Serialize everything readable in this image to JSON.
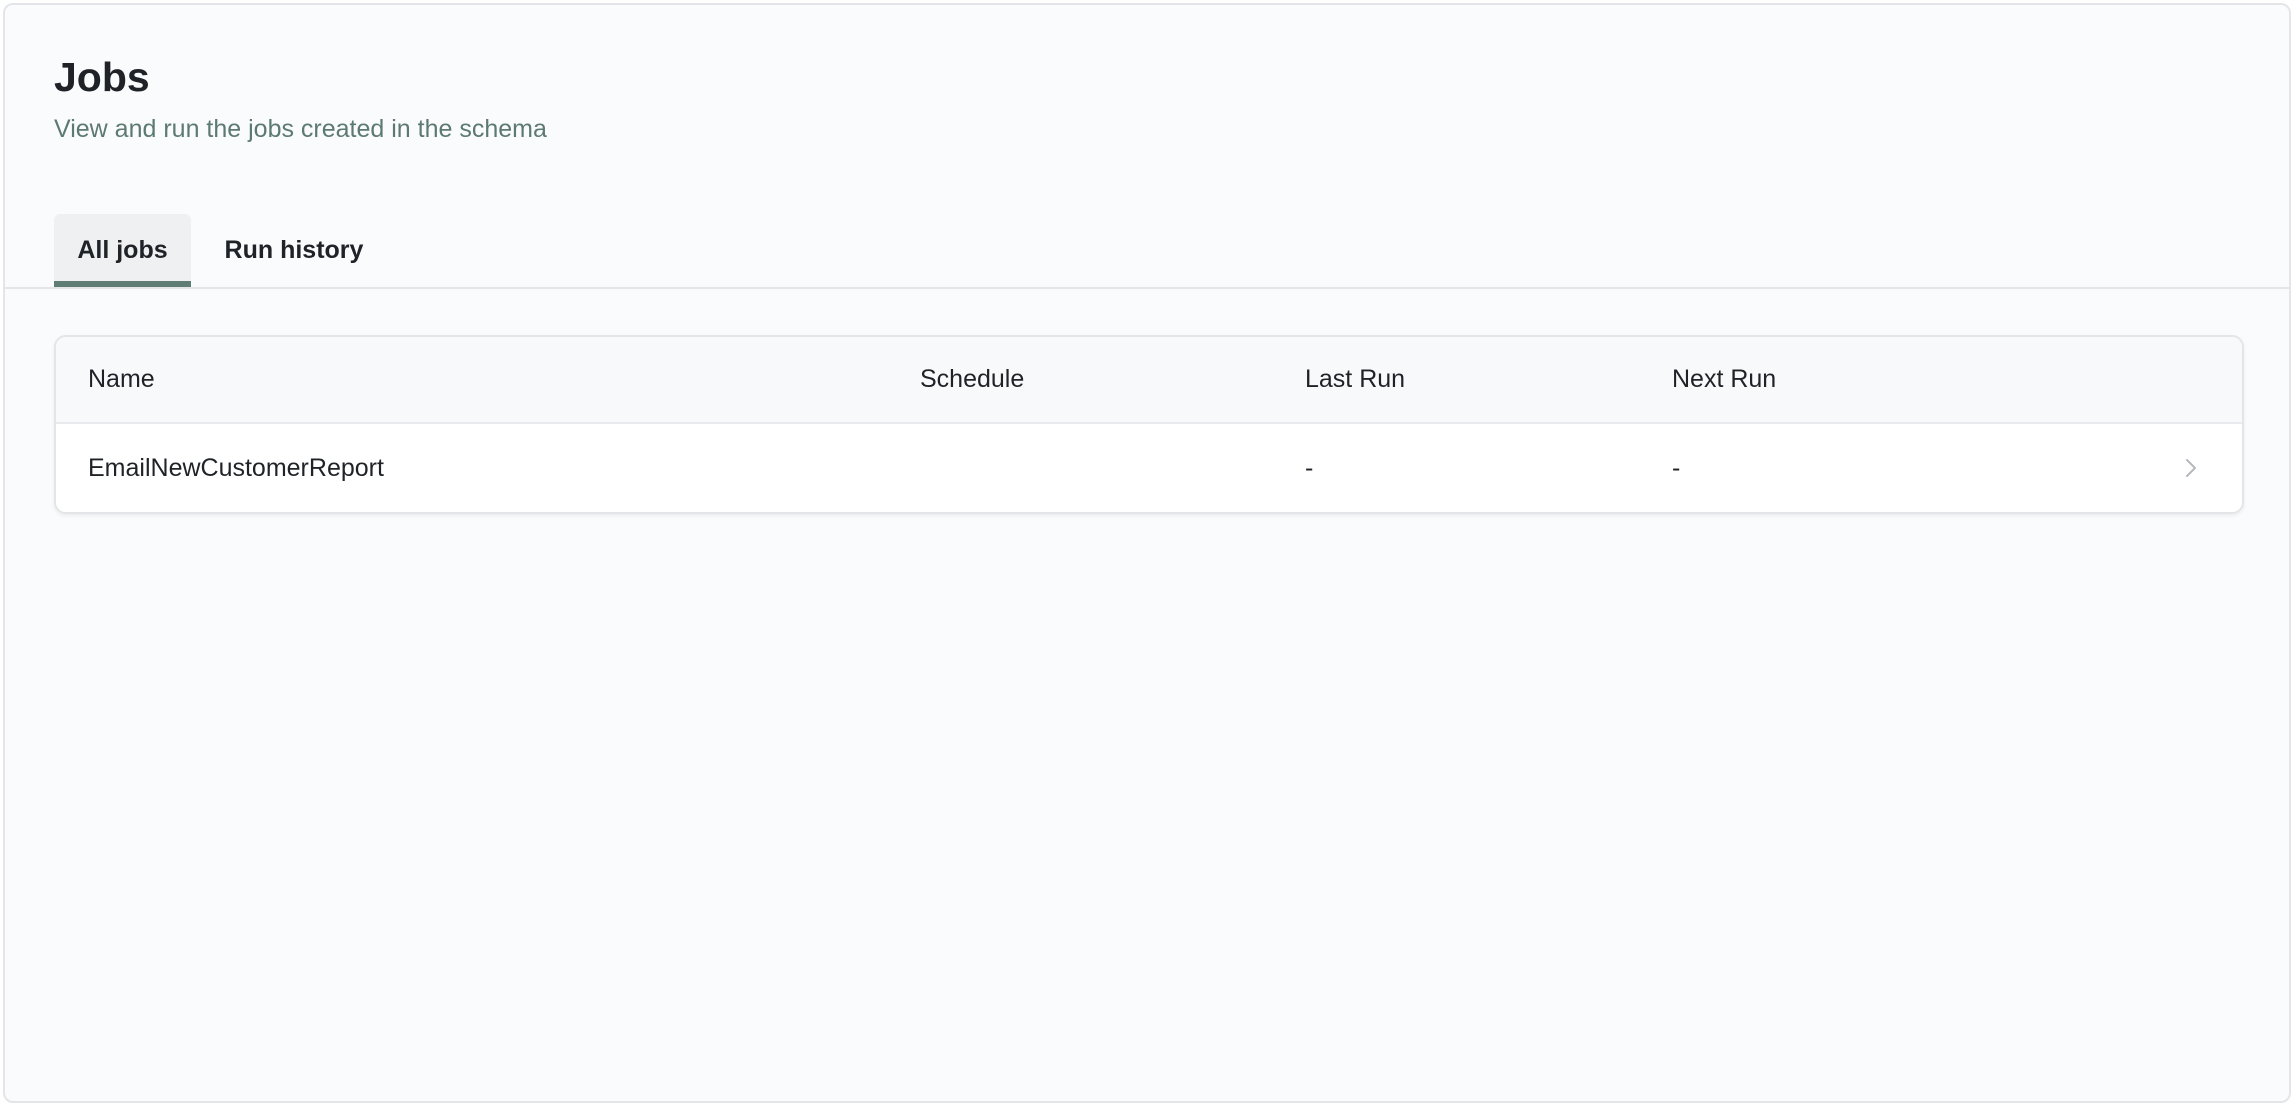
{
  "header": {
    "title": "Jobs",
    "subtitle": "View and run the jobs created in the schema"
  },
  "tabs": [
    {
      "label": "All jobs",
      "active": true
    },
    {
      "label": "Run history",
      "active": false
    }
  ],
  "table": {
    "columns": [
      "Name",
      "Schedule",
      "Last Run",
      "Next Run"
    ],
    "rows": [
      {
        "name": "EmailNewCustomerReport",
        "schedule": "",
        "last_run": "-",
        "next_run": "-",
        "icon": "chevron-right-icon"
      }
    ]
  },
  "colors": {
    "accent": "#5f7d75",
    "subtitle": "#5d7a72",
    "text": "#1f2328",
    "background": "#fafbfd"
  }
}
